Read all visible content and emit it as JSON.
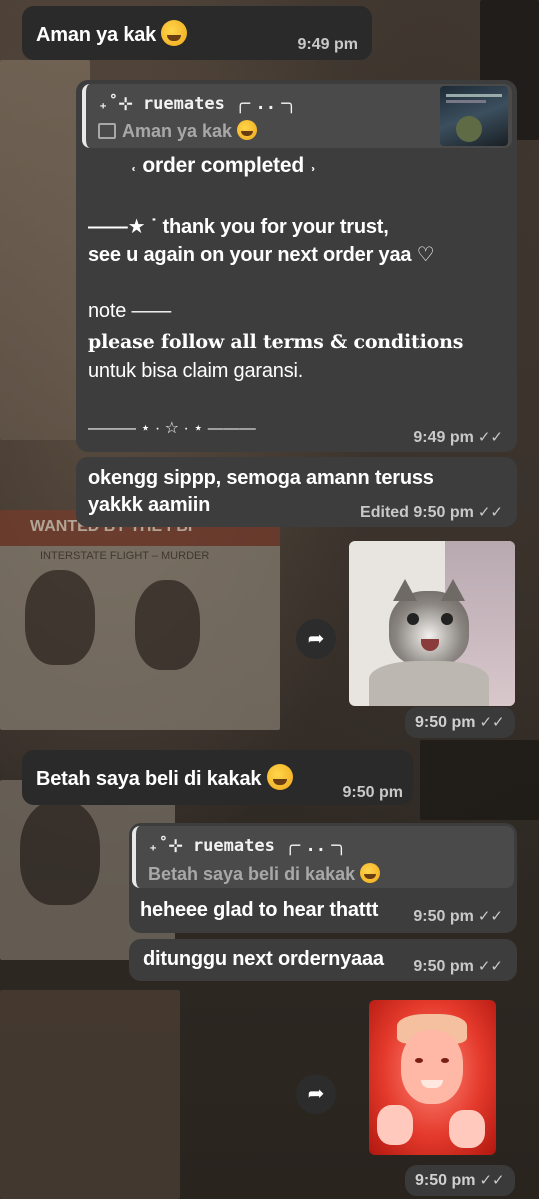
{
  "messages": {
    "m1": {
      "text": "Aman ya kak",
      "time": "9:49 pm"
    },
    "m2": {
      "quote_name": "₊˚⊹ ruemates ╭╴..╶╮",
      "quote_text": "Aman ya kak",
      "heading": "˓ order completed ˒",
      "line1": "——★ ˙ thank you for your trust,",
      "line2": "see u again on your next order yaa ♡",
      "note_label": "note ——",
      "note_line1": "please follow all terms & conditions",
      "note_line2": "untuk bisa claim garansi.",
      "divider": "——— ⋆ · ☆ · ⋆ ———",
      "time": "9:49 pm"
    },
    "m3": {
      "line1": "okengg sippp, semoga amann teruss",
      "line2": "yakkk aamiin",
      "edited": "Edited",
      "time": "9:50 pm"
    },
    "m4": {
      "time": "9:50 pm"
    },
    "m5": {
      "text": "Betah saya beli di kakak",
      "time": "9:50 pm"
    },
    "m6": {
      "quote_name": "₊˚⊹ ruemates ╭╴..╶╮",
      "quote_text": "Betah saya beli di kakak",
      "text": "heheee glad to hear thattt",
      "time": "9:50 pm"
    },
    "m7": {
      "text": "ditunggu next ordernyaaa",
      "time": "9:50 pm"
    },
    "m8": {
      "time": "9:50 pm"
    }
  },
  "icons": {
    "forward": "forward-arrow-icon",
    "read": "double-check-icon",
    "emoji": "rolling-laughing-emoji"
  },
  "wallpaper_text": {
    "poster_title": "WANTED BY THE FBI",
    "poster_sub": "INTERSTATE FLIGHT – MURDER"
  }
}
